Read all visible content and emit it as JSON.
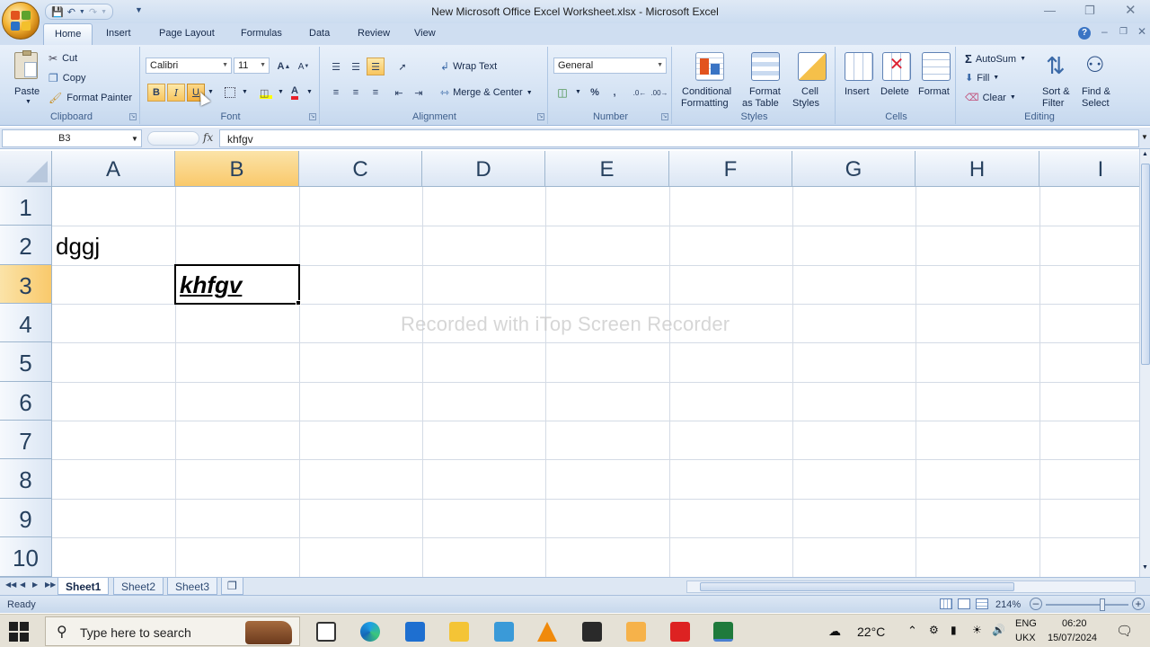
{
  "window": {
    "title": "New Microsoft Office Excel Worksheet.xlsx - Microsoft Excel"
  },
  "ribbon_tabs": [
    "Home",
    "Insert",
    "Page Layout",
    "Formulas",
    "Data",
    "Review",
    "View"
  ],
  "ribbon": {
    "clipboard": {
      "paste": "Paste",
      "cut": "Cut",
      "copy": "Copy",
      "format_painter": "Format Painter",
      "label": "Clipboard"
    },
    "font": {
      "name": "Calibri",
      "size": "11",
      "bold": "B",
      "italic": "I",
      "underline": "U",
      "label": "Font"
    },
    "alignment": {
      "wrap_text": "Wrap Text",
      "merge_center": "Merge & Center",
      "label": "Alignment"
    },
    "number": {
      "format": "General",
      "percent": "%",
      "comma": ",",
      "label": "Number"
    },
    "styles": {
      "conditional_1": "Conditional",
      "conditional_2": "Formatting",
      "format_table_1": "Format",
      "format_table_2": "as Table",
      "cell_styles_1": "Cell",
      "cell_styles_2": "Styles",
      "label": "Styles"
    },
    "cells": {
      "insert": "Insert",
      "delete": "Delete",
      "format": "Format",
      "label": "Cells"
    },
    "editing": {
      "autosum": "AutoSum",
      "fill": "Fill",
      "clear": "Clear",
      "sort_1": "Sort &",
      "sort_2": "Filter",
      "find_1": "Find &",
      "find_2": "Select",
      "label": "Editing"
    }
  },
  "formula_bar": {
    "name_box": "B3",
    "fx": "fx",
    "content": "khfgv"
  },
  "grid": {
    "columns": [
      "A",
      "B",
      "C",
      "D",
      "E",
      "F",
      "G",
      "H",
      "I"
    ],
    "rows": [
      "1",
      "2",
      "3",
      "4",
      "5",
      "6",
      "7",
      "8",
      "9",
      "10"
    ],
    "selected_column": "B",
    "selected_row": "3",
    "cells": {
      "A2": "dggj",
      "B3": "khfgv"
    }
  },
  "watermark": "Recorded with iTop Screen Recorder",
  "sheets": [
    "Sheet1",
    "Sheet2",
    "Sheet3"
  ],
  "active_sheet": "Sheet1",
  "status": {
    "text": "Ready",
    "zoom": "214%"
  },
  "taskbar": {
    "search_placeholder": "Type here to search",
    "temperature": "22°C",
    "language_1": "ENG",
    "language_2": "UKX",
    "time": "06:20",
    "date": "15/07/2024"
  }
}
